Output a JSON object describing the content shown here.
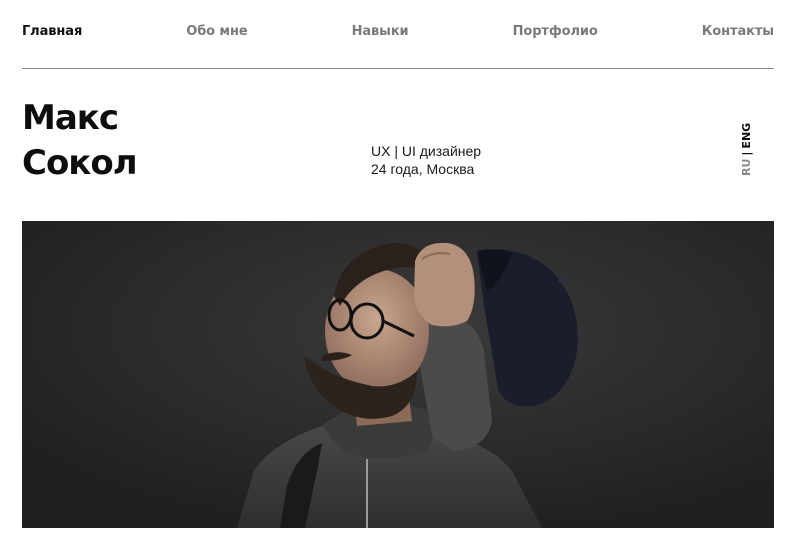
{
  "nav": {
    "items": [
      {
        "label": "Главная",
        "active": true
      },
      {
        "label": "Обо мне",
        "active": false
      },
      {
        "label": "Навыки",
        "active": false
      },
      {
        "label": "Портфолио",
        "active": false
      },
      {
        "label": "Контакты",
        "active": false
      }
    ]
  },
  "profile": {
    "first_name": "Макс",
    "last_name": "Сокол",
    "role": "UX | UI дизайнер",
    "details": "24 года, Москва"
  },
  "language": {
    "options": [
      "RU",
      "ENG"
    ],
    "separator": "|",
    "selected": "ENG"
  },
  "hero": {
    "background_color": "#262626"
  }
}
